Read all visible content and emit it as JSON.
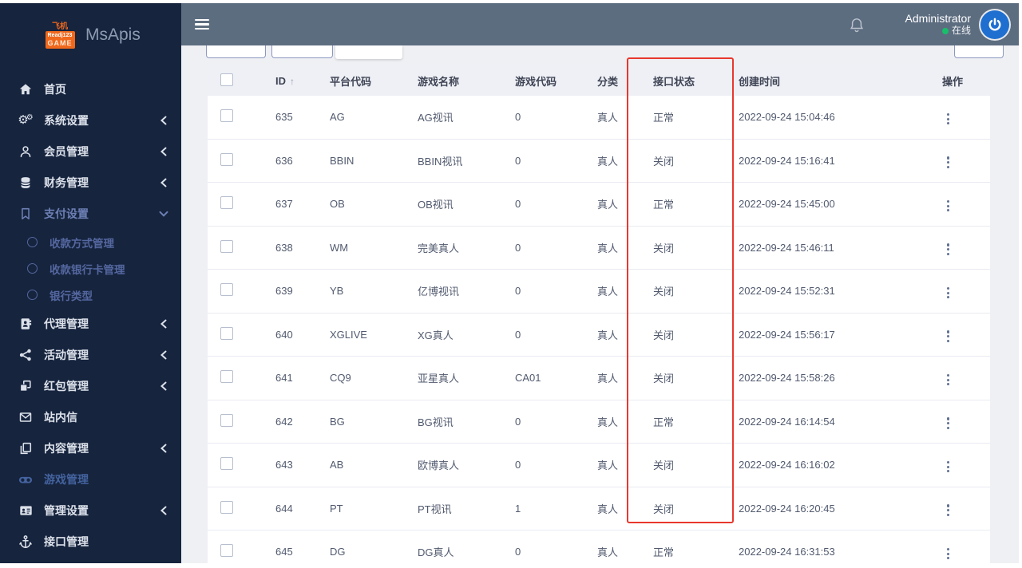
{
  "logo": {
    "badge_line1": "飞机",
    "badge_line2": "Readj123",
    "badge_line3": "GAME",
    "title": "MsApis"
  },
  "topbar": {
    "user_name": "Administrator",
    "user_status": "在线"
  },
  "sidebar": {
    "items": [
      {
        "key": "home",
        "label": "首页",
        "icon": "home-icon",
        "chevron": null,
        "state": "normal",
        "sub": false
      },
      {
        "key": "system-settings",
        "label": "系统设置",
        "icon": "gears-icon",
        "chevron": "left",
        "state": "normal",
        "sub": false
      },
      {
        "key": "member-management",
        "label": "会员管理",
        "icon": "user-icon",
        "chevron": "left",
        "state": "normal",
        "sub": false
      },
      {
        "key": "finance-management",
        "label": "财务管理",
        "icon": "database-icon",
        "chevron": "left",
        "state": "normal",
        "sub": false
      },
      {
        "key": "payment-settings",
        "label": "支付设置",
        "icon": "bookmark-icon",
        "chevron": "down",
        "state": "open",
        "sub": false
      },
      {
        "key": "payment-method-management",
        "label": "收款方式管理",
        "icon": "circle-icon",
        "chevron": null,
        "state": "normal",
        "sub": true
      },
      {
        "key": "payment-bank-card-management",
        "label": "收款银行卡管理",
        "icon": "circle-icon",
        "chevron": null,
        "state": "normal",
        "sub": true
      },
      {
        "key": "bank-type",
        "label": "银行类型",
        "icon": "circle-icon",
        "chevron": null,
        "state": "normal",
        "sub": true
      },
      {
        "key": "agent-management",
        "label": "代理管理",
        "icon": "address-book-icon",
        "chevron": "left",
        "state": "normal",
        "sub": false
      },
      {
        "key": "activity-management",
        "label": "活动管理",
        "icon": "share-icon",
        "chevron": "left",
        "state": "normal",
        "sub": false
      },
      {
        "key": "redpacket-management",
        "label": "红包管理",
        "icon": "boxes-icon",
        "chevron": "left",
        "state": "normal",
        "sub": false
      },
      {
        "key": "site-message",
        "label": "站内信",
        "icon": "envelope-icon",
        "chevron": null,
        "state": "normal",
        "sub": false
      },
      {
        "key": "content-management",
        "label": "内容管理",
        "icon": "copy-icon",
        "chevron": "left",
        "state": "normal",
        "sub": false
      },
      {
        "key": "game-management",
        "label": "游戏管理",
        "icon": "gamepad-icon",
        "chevron": null,
        "state": "active",
        "sub": false
      },
      {
        "key": "admin-settings",
        "label": "管理设置",
        "icon": "id-card-icon",
        "chevron": "left",
        "state": "normal",
        "sub": false
      },
      {
        "key": "api-management",
        "label": "接口管理",
        "icon": "anchor-icon",
        "chevron": null,
        "state": "normal",
        "sub": false
      }
    ]
  },
  "table": {
    "columns": [
      {
        "key": "select",
        "label": ""
      },
      {
        "key": "id",
        "label": "ID",
        "sort": "↑"
      },
      {
        "key": "platform_code",
        "label": "平台代码"
      },
      {
        "key": "game_name",
        "label": "游戏名称"
      },
      {
        "key": "game_code",
        "label": "游戏代码"
      },
      {
        "key": "category",
        "label": "分类"
      },
      {
        "key": "api_status",
        "label": "接口状态"
      },
      {
        "key": "created_at",
        "label": "创建时间"
      },
      {
        "key": "actions",
        "label": "操作"
      }
    ],
    "rows": [
      {
        "id": "635",
        "platform_code": "AG",
        "game_name": "AG视讯",
        "game_code": "0",
        "category": "真人",
        "api_status": "正常",
        "created_at": "2022-09-24 15:04:46"
      },
      {
        "id": "636",
        "platform_code": "BBIN",
        "game_name": "BBIN视讯",
        "game_code": "0",
        "category": "真人",
        "api_status": "关闭",
        "created_at": "2022-09-24 15:16:41"
      },
      {
        "id": "637",
        "platform_code": "OB",
        "game_name": "OB视讯",
        "game_code": "0",
        "category": "真人",
        "api_status": "正常",
        "created_at": "2022-09-24 15:45:00"
      },
      {
        "id": "638",
        "platform_code": "WM",
        "game_name": "完美真人",
        "game_code": "0",
        "category": "真人",
        "api_status": "关闭",
        "created_at": "2022-09-24 15:46:11"
      },
      {
        "id": "639",
        "platform_code": "YB",
        "game_name": "亿博视讯",
        "game_code": "0",
        "category": "真人",
        "api_status": "关闭",
        "created_at": "2022-09-24 15:52:31"
      },
      {
        "id": "640",
        "platform_code": "XGLIVE",
        "game_name": "XG真人",
        "game_code": "0",
        "category": "真人",
        "api_status": "关闭",
        "created_at": "2022-09-24 15:56:17"
      },
      {
        "id": "641",
        "platform_code": "CQ9",
        "game_name": "亚星真人",
        "game_code": "CA01",
        "category": "真人",
        "api_status": "关闭",
        "created_at": "2022-09-24 15:58:26"
      },
      {
        "id": "642",
        "platform_code": "BG",
        "game_name": "BG视讯",
        "game_code": "0",
        "category": "真人",
        "api_status": "正常",
        "created_at": "2022-09-24 16:14:54"
      },
      {
        "id": "643",
        "platform_code": "AB",
        "game_name": "欧博真人",
        "game_code": "0",
        "category": "真人",
        "api_status": "关闭",
        "created_at": "2022-09-24 16:16:02"
      },
      {
        "id": "644",
        "platform_code": "PT",
        "game_name": "PT视讯",
        "game_code": "1",
        "category": "真人",
        "api_status": "关闭",
        "created_at": "2022-09-24 16:20:45"
      },
      {
        "id": "645",
        "platform_code": "DG",
        "game_name": "DG真人",
        "game_code": "0",
        "category": "真人",
        "api_status": "正常",
        "created_at": "2022-09-24 16:31:53"
      }
    ]
  },
  "colors": {
    "sidebar_bg": "#16243e",
    "topbar_bg": "#5d6d80",
    "content_bg": "#eff0f4",
    "accent_blue": "#1e6fd0",
    "online_green": "#19be6b",
    "highlight_red": "#e8382d",
    "active_item_blue": "#44639f"
  }
}
